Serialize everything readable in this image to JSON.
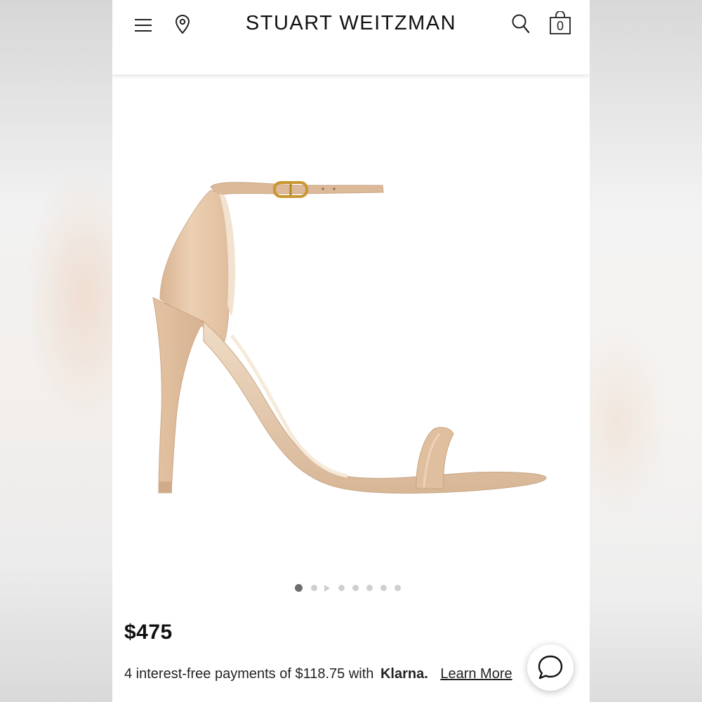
{
  "header": {
    "brand": "STUART WEITZMAN",
    "bag_count": "0"
  },
  "product": {
    "image_alt": "Nude ankle-strap high heel sandal",
    "price": "$475",
    "gallery_total": 8,
    "gallery_active": 1
  },
  "klarna": {
    "text": "4 interest-free payments of $118.75 with",
    "brand": "Klarna.",
    "learn_more": "Learn More"
  },
  "colors": {
    "leather": "#e2c0a0",
    "buckle": "#c9962f"
  },
  "icons": {
    "menu": "hamburger-menu-icon",
    "location": "map-pin-icon",
    "search": "search-icon",
    "bag": "shopping-bag-icon",
    "chat": "chat-bubble-icon"
  }
}
